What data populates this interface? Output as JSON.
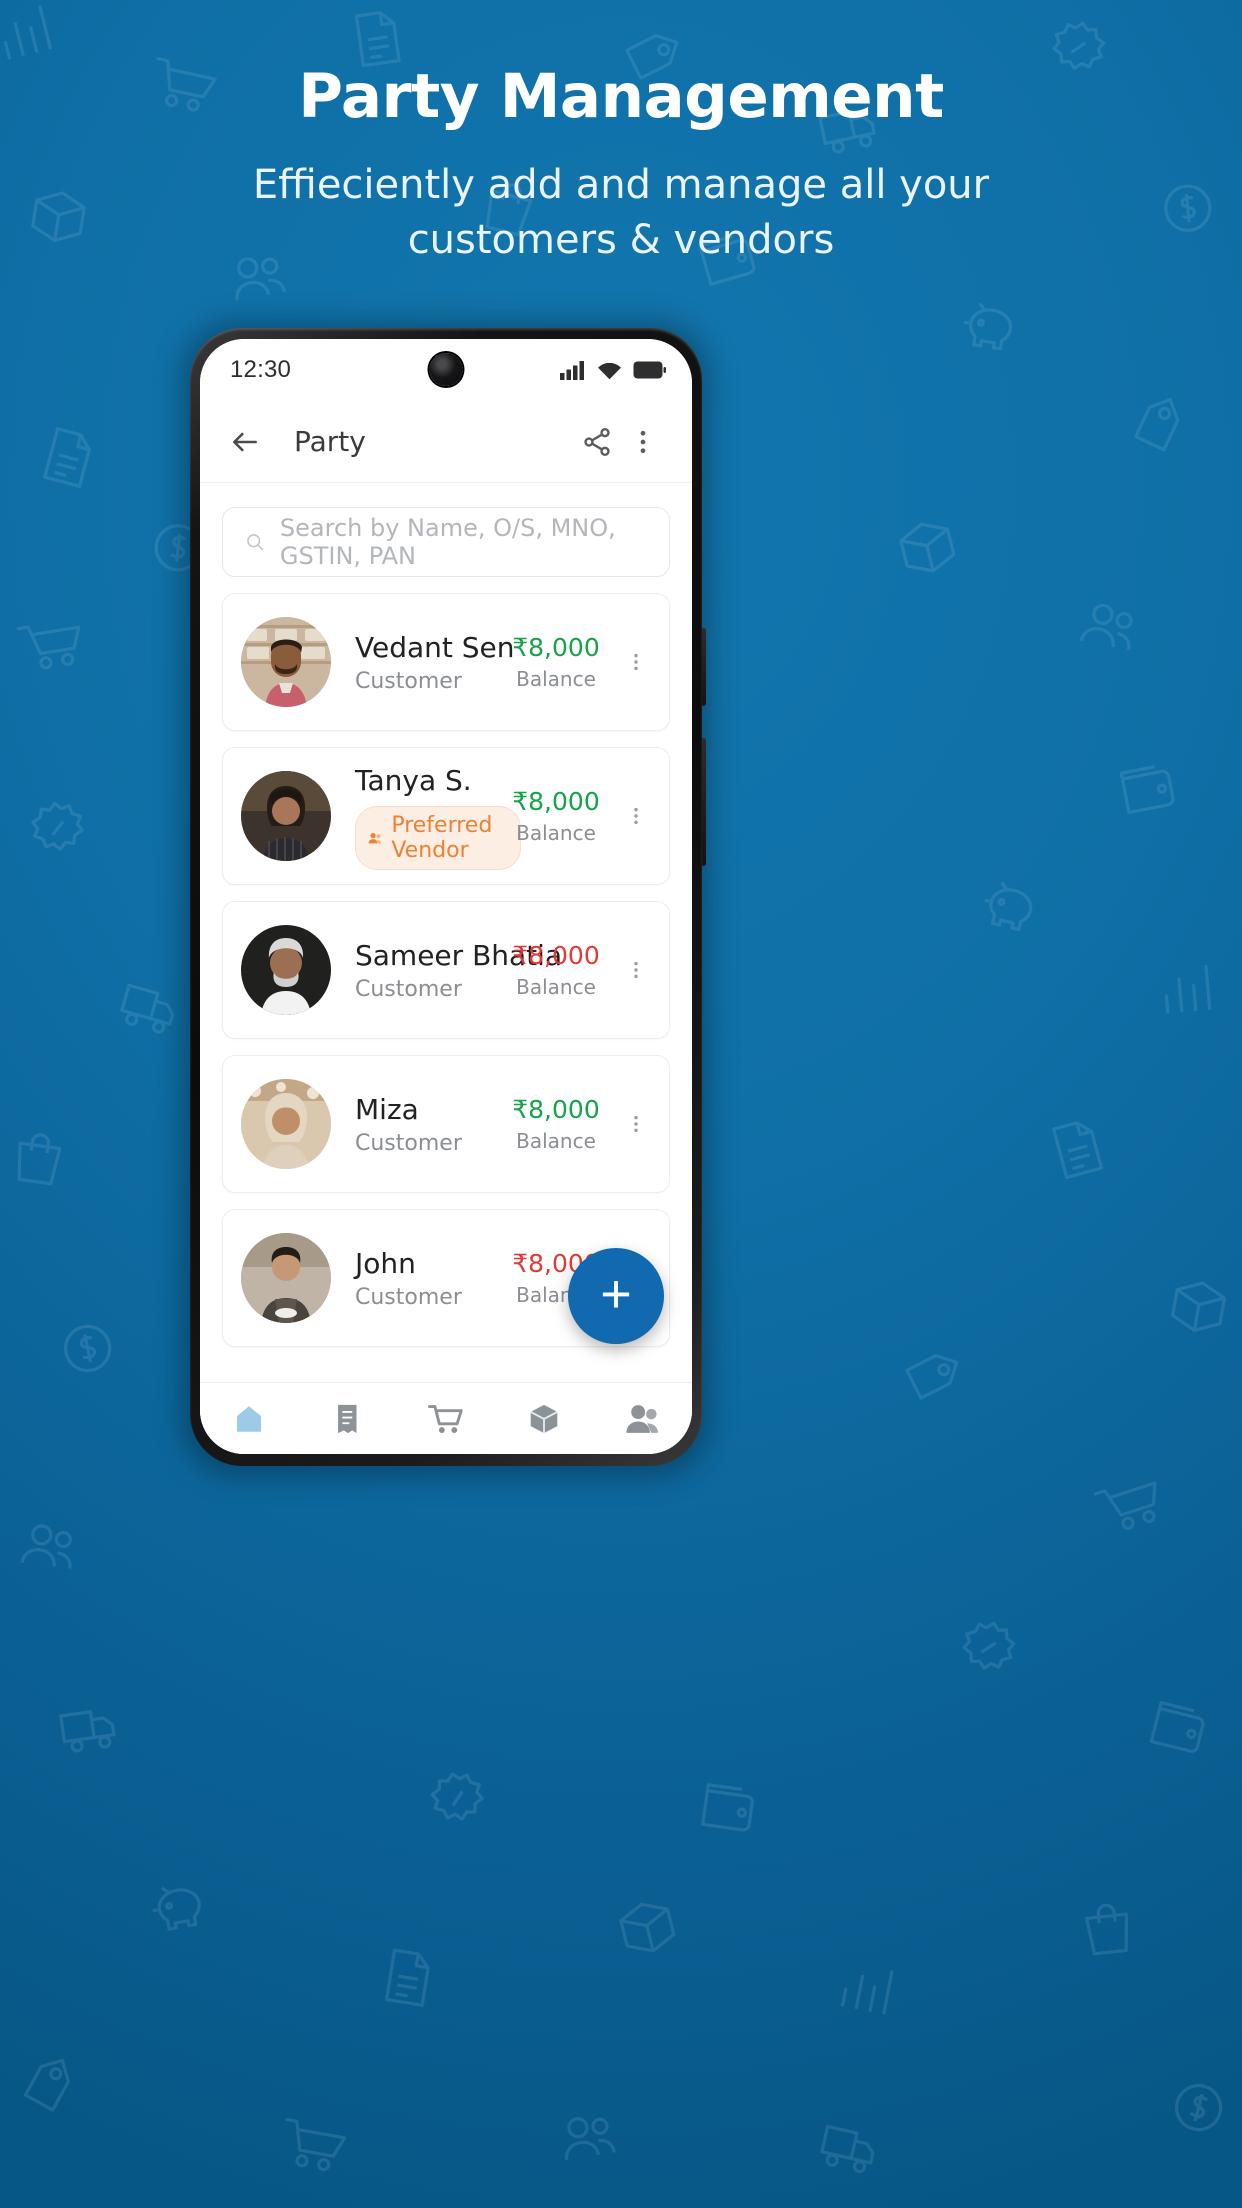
{
  "hero": {
    "title": "Party Management",
    "subtitle": "Effieciently add and manage all your customers & vendors"
  },
  "colors": {
    "background": "#0d6ba3",
    "accent": "#1169b0",
    "positive": "#16a34a",
    "negative": "#e53935",
    "badge_text": "#ef8034",
    "badge_bg": "#fdeee4"
  },
  "phone": {
    "statusbar": {
      "time": "12:30",
      "icons": [
        "signal-icon",
        "wifi-icon",
        "battery-icon"
      ]
    },
    "appbar": {
      "back_icon": "arrow-left-icon",
      "title": "Party",
      "share_icon": "share-icon",
      "overflow_icon": "more-vertical-icon"
    },
    "search": {
      "icon": "search-icon",
      "placeholder": "Search by Name, O/S, MNO, GSTIN, PAN",
      "value": ""
    },
    "parties": [
      {
        "name": "Vedant Sen",
        "subtitle": "Customer",
        "badge": null,
        "balance": "₹8,000",
        "balance_label": "Balance",
        "balance_sign": "pos"
      },
      {
        "name": "Tanya S.",
        "subtitle": null,
        "badge": "Preferred Vendor",
        "balance": "₹8,000",
        "balance_label": "Balance",
        "balance_sign": "pos"
      },
      {
        "name": "Sameer Bhatia",
        "subtitle": "Customer",
        "badge": null,
        "balance": "₹8,000",
        "balance_label": "Balance",
        "balance_sign": "neg"
      },
      {
        "name": "Miza",
        "subtitle": "Customer",
        "badge": null,
        "balance": "₹8,000",
        "balance_label": "Balance",
        "balance_sign": "pos"
      },
      {
        "name": "John",
        "subtitle": "Customer",
        "badge": null,
        "balance": "₹8,000",
        "balance_label": "Balance",
        "balance_sign": "neg"
      }
    ],
    "fab": {
      "icon": "plus-icon",
      "label": "+"
    },
    "bottom_nav": [
      {
        "icon": "home-icon",
        "active": true
      },
      {
        "icon": "invoice-icon",
        "active": false
      },
      {
        "icon": "cart-icon",
        "active": false
      },
      {
        "icon": "box-icon",
        "active": false
      },
      {
        "icon": "people-icon",
        "active": false
      }
    ]
  }
}
